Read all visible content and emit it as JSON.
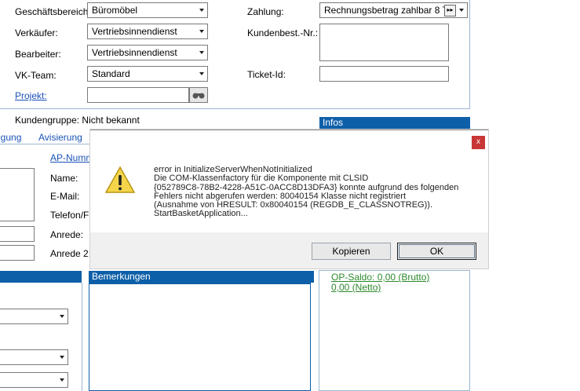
{
  "form": {
    "geschaeftsbereich_label": "Geschäftsbereich:",
    "geschaeftsbereich_value": "Büromöbel",
    "verkaeufer_label": "Verkäufer:",
    "verkaeufer_value": "Vertriebsinnendienst",
    "bearbeiter_label": "Bearbeiter:",
    "bearbeiter_value": "Vertriebsinnendienst",
    "vkteam_label": "VK-Team:",
    "vkteam_value": "Standard",
    "projekt_label": "Projekt:",
    "projekt_value": "",
    "zahlung_label": "Zahlung:",
    "zahlung_value": "Rechnungsbetrag zahlbar 8 T",
    "kundenbest_label": "Kundenbest.-Nr.:",
    "ticket_label": "Ticket-Id:",
    "kundengruppe": "Kundengruppe: Nicht bekannt",
    "infos_header": "Infos"
  },
  "tabs": [
    "igung",
    "Avisierung"
  ],
  "contact": {
    "ap_link": "AP-Numm",
    "name_label": "Name:",
    "email_label": "E-Mail:",
    "telefon_label": "Telefon/Fa",
    "anrede_label": "Anrede:",
    "anrede2_label": "Anrede 2:"
  },
  "lower": {
    "bemerkungen": "Bemerkungen",
    "op_saldo": "OP-Saldo: 0,00 (Brutto)",
    "netto": "0,00 (Netto)"
  },
  "dialog": {
    "close": "x",
    "lines": [
      "error in InitializeServerWhenNotInitialized",
      "Die COM-Klassenfactory für die Komponente mit CLSID",
      "{052789C8-78B2-4228-A51C-0ACC8D13DFA3} konnte aufgrund des folgenden",
      "Fehlers nicht abgerufen werden: 80040154 Klasse nicht registriert",
      "(Ausnahme von HRESULT: 0x80040154 (REGDB_E_CLASSNOTREG)).",
      "StartBasketApplication..."
    ],
    "copy_button": "Kopieren",
    "ok_button": "OK"
  },
  "colors": {
    "header_blue": "#0d5fa8",
    "link_blue": "#1a52b8",
    "saldo_green": "#2c8a2c",
    "close_red": "#c93636"
  }
}
